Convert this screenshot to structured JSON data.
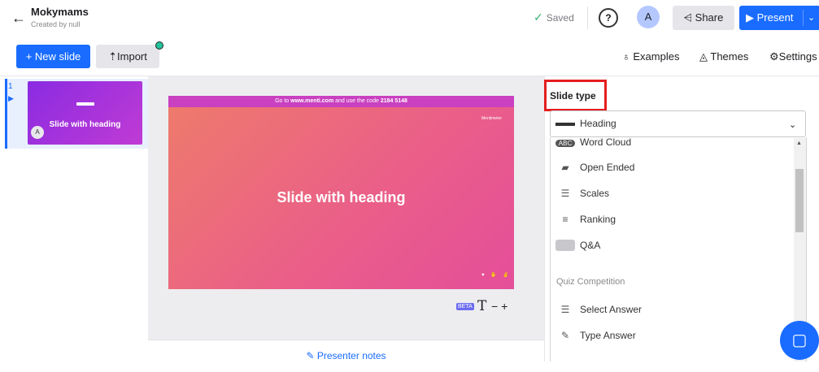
{
  "header": {
    "back_icon": "arrow-left-icon",
    "title": "Mokymams",
    "subtitle": "Created by null",
    "saved_label": "Saved",
    "help_label": "?",
    "avatar_initial": "A",
    "share_label": "Share",
    "present_label": "Present"
  },
  "toolbar": {
    "new_slide_label": "+ New slide",
    "import_label": "Import",
    "examples_label": "Examples",
    "themes_label": "Themes",
    "settings_label": "Settings"
  },
  "slides": [
    {
      "number": "1",
      "title": "Slide with heading",
      "avatar": "A"
    }
  ],
  "preview": {
    "banner_prefix": "Go to",
    "banner_url": "www.menti.com",
    "banner_middle": "and use the code",
    "banner_code": "2184 5148",
    "brand": "Mentimeter",
    "heading": "Slide with heading",
    "beta_label": "BETA",
    "text_symbol": "T",
    "zoom_controls": "− +",
    "presenter_notes_label": "Presenter notes"
  },
  "slide_type": {
    "label": "Slide type",
    "selected": "Heading",
    "options": [
      {
        "label": "Word Cloud",
        "icon": "abc-icon"
      },
      {
        "label": "Open Ended",
        "icon": "speech-bubbles-icon"
      },
      {
        "label": "Scales",
        "icon": "sliders-icon"
      },
      {
        "label": "Ranking",
        "icon": "ranking-bars-icon"
      },
      {
        "label": "Q&A",
        "icon": "qa-bubble-icon"
      }
    ],
    "section_quiz": "Quiz Competition",
    "quiz_options": [
      {
        "label": "Select Answer",
        "icon": "list-lines-icon"
      },
      {
        "label": "Type Answer",
        "icon": "pencil-icon"
      }
    ]
  },
  "colors": {
    "accent": "#196cff",
    "highlight_box": "#e41e1e",
    "slide_gradient_start": "#ee7a6c",
    "slide_gradient_end": "#e54e9a"
  }
}
